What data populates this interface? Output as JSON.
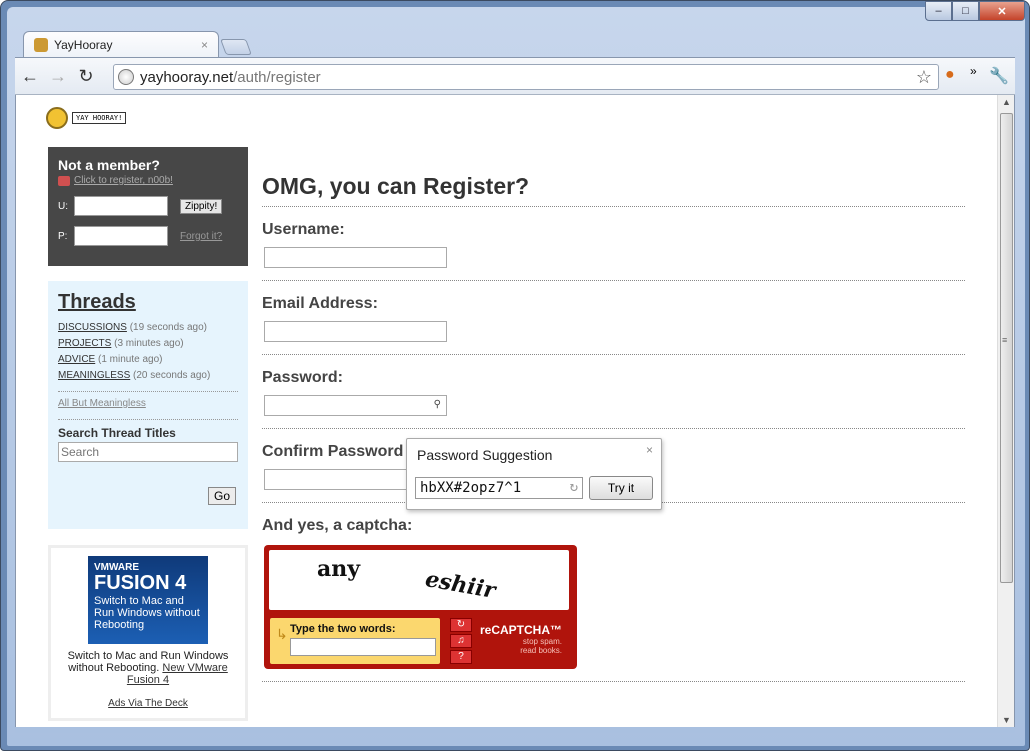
{
  "browser": {
    "tab_title": "YayHooray",
    "tab_close": "×",
    "url_host": "yayhooray.net",
    "url_path": "/auth/register"
  },
  "logo": {
    "bubble_text": "YAY HOORAY!"
  },
  "login": {
    "heading": "Not a member?",
    "register_link": "Click to register, n00b!",
    "user_label": "U:",
    "pass_label": "P:",
    "submit": "Zippity!",
    "forgot": "Forgot it?"
  },
  "threads": {
    "title": "Threads",
    "items": [
      {
        "label": "DISCUSSIONS",
        "time": "(19 seconds ago)"
      },
      {
        "label": "PROJECTS",
        "time": "(3 minutes ago)"
      },
      {
        "label": "ADVICE",
        "time": "(1 minute ago)"
      },
      {
        "label": "MEANINGLESS",
        "time": "(20 seconds ago)"
      }
    ],
    "all_but": "All But Meaningless",
    "search_title": "Search Thread Titles",
    "search_placeholder": "Search",
    "go": "Go"
  },
  "ad": {
    "banner_line1": "VMWARE",
    "banner_line2": "FUSION 4",
    "banner_line3": "Switch to Mac and Run Windows without Rebooting",
    "text": "Switch to Mac and Run Windows without Rebooting.",
    "link": "New VMware Fusion 4",
    "via": "Ads Via The Deck"
  },
  "form": {
    "title": "OMG, you can Register?",
    "username_label": "Username:",
    "email_label": "Email Address:",
    "password_label": "Password:",
    "confirm_label": "Confirm Password",
    "captcha_label": "And yes, a captcha:"
  },
  "password_popup": {
    "title": "Password Suggestion",
    "suggestion": "hbXX#2opz7^1",
    "try_button": "Try it",
    "close": "×"
  },
  "captcha": {
    "word1": "any",
    "word2": "eshiir",
    "prompt": "Type the two words:",
    "brand": "reCAPTCHA™",
    "tagline1": "stop spam.",
    "tagline2": "read books."
  }
}
